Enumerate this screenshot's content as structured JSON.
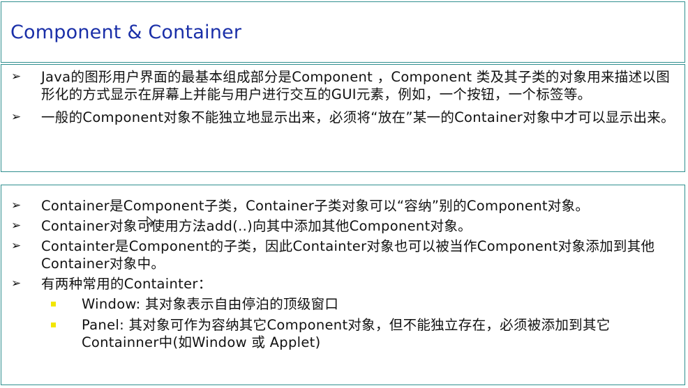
{
  "title": "Component & Container",
  "section1": {
    "items": [
      {
        "text": "Java的图形用户界面的最基本组成部分是Component ，Component 类及其子类的对象用来描述以图形化的方式显示在屏幕上并能与用户进行交互的GUI元素，例如，一个按钮，一个标签等。"
      },
      {
        "text": "一般的Component对象不能独立地显示出来，必须将“放在”某一的Container对象中才可以显示出来。"
      }
    ]
  },
  "section2": {
    "items": [
      {
        "text": "Container是Component子类，Container子类对象可以“容纳”别的Component对象。"
      },
      {
        "text": "Container对象可使用方法add(..)向其中添加其他Component对象。"
      },
      {
        "text": "Containter是Component的子类，因此Containter对象也可以被当作Component对象添加到其他Container对象中。"
      },
      {
        "text": "有两种常用的Containter："
      }
    ],
    "subitems": [
      {
        "text": "Window: 其对象表示自由停泊的顶级窗口"
      },
      {
        "text": "Panel: 其对象可作为容纳其它Component对象，但不能独立存在，必须被添加到其它Containner中(如Window 或 Applet)"
      }
    ]
  },
  "icons": {
    "bullet_arrow": "arrowhead-bullet-icon",
    "bullet_square": "yellow-square-bullet-icon",
    "cursor": "mouse-pointer-icon"
  },
  "colors": {
    "title": "#1a2fa8",
    "border": "#2f8f8f",
    "sub_bullet": "#f2e600"
  }
}
